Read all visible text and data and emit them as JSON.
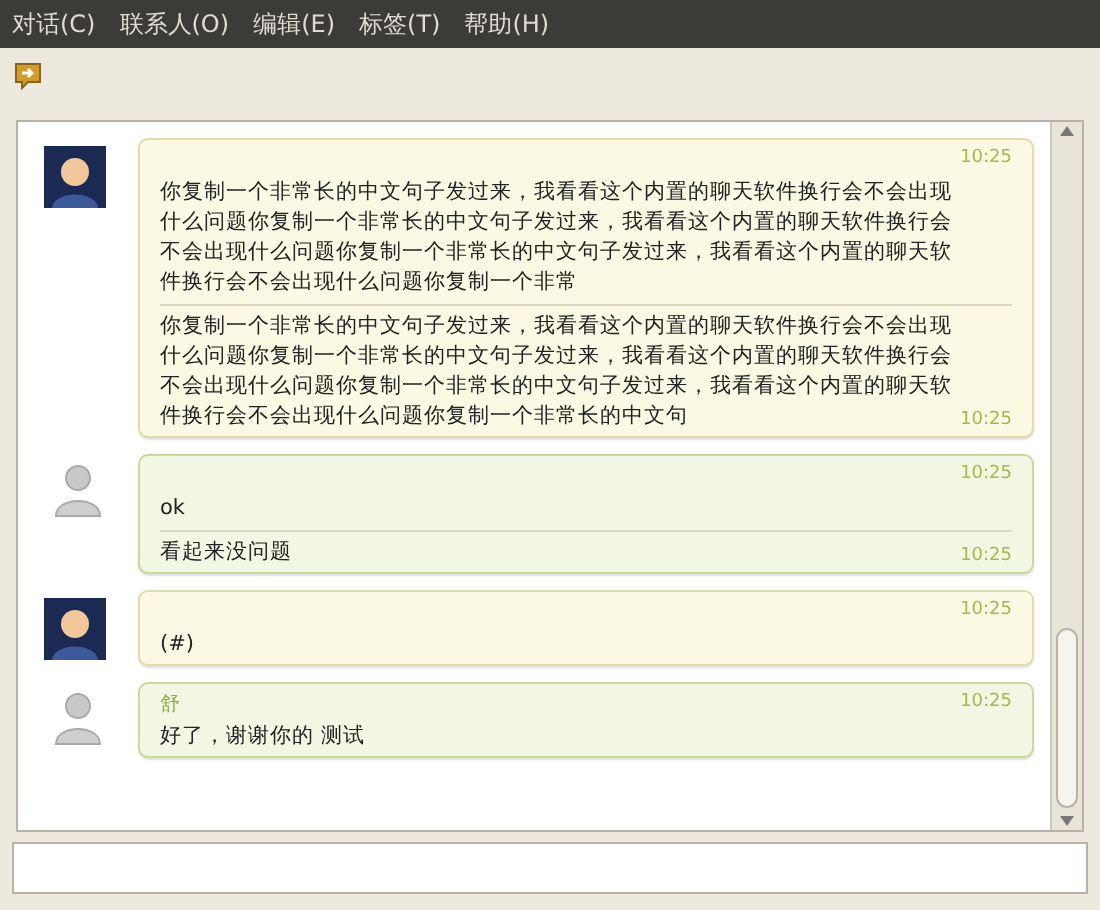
{
  "menu": [
    {
      "label": "对话(C)"
    },
    {
      "label": "联系人(O)"
    },
    {
      "label": "编辑(E)"
    },
    {
      "label": "标签(T)"
    },
    {
      "label": "帮助(H)"
    }
  ],
  "conversation": [
    {
      "kind": "contact",
      "time": "10:25",
      "messages": [
        {
          "text": "你复制一个非常长的中文句子发过来，我看看这个内置的聊天软件换行会不会出现什么问题你复制一个非常长的中文句子发过来，我看看这个内置的聊天软件换行会不会出现什么问题你复制一个非常长的中文句子发过来，我看看这个内置的聊天软件换行会不会出现什么问题你复制一个非常"
        },
        {
          "text": "你复制一个非常长的中文句子发过来，我看看这个内置的聊天软件换行会不会出现什么问题你复制一个非常长的中文句子发过来，我看看这个内置的聊天软件换行会不会出现什么问题你复制一个非常长的中文句子发过来，我看看这个内置的聊天软件换行会不会出现什么问题你复制一个非常长的中文句",
          "time": "10:25"
        }
      ]
    },
    {
      "kind": "self",
      "time": "10:25",
      "messages": [
        {
          "text": "ok"
        },
        {
          "text": "看起来没问题",
          "time": "10:25"
        }
      ]
    },
    {
      "kind": "contact",
      "time": "10:25",
      "messages": [
        {
          "text": "(#)"
        }
      ]
    },
    {
      "kind": "self",
      "sender": "舒",
      "time": "10:25",
      "messages": [
        {
          "text": "好了，谢谢你的 测试"
        }
      ]
    }
  ]
}
